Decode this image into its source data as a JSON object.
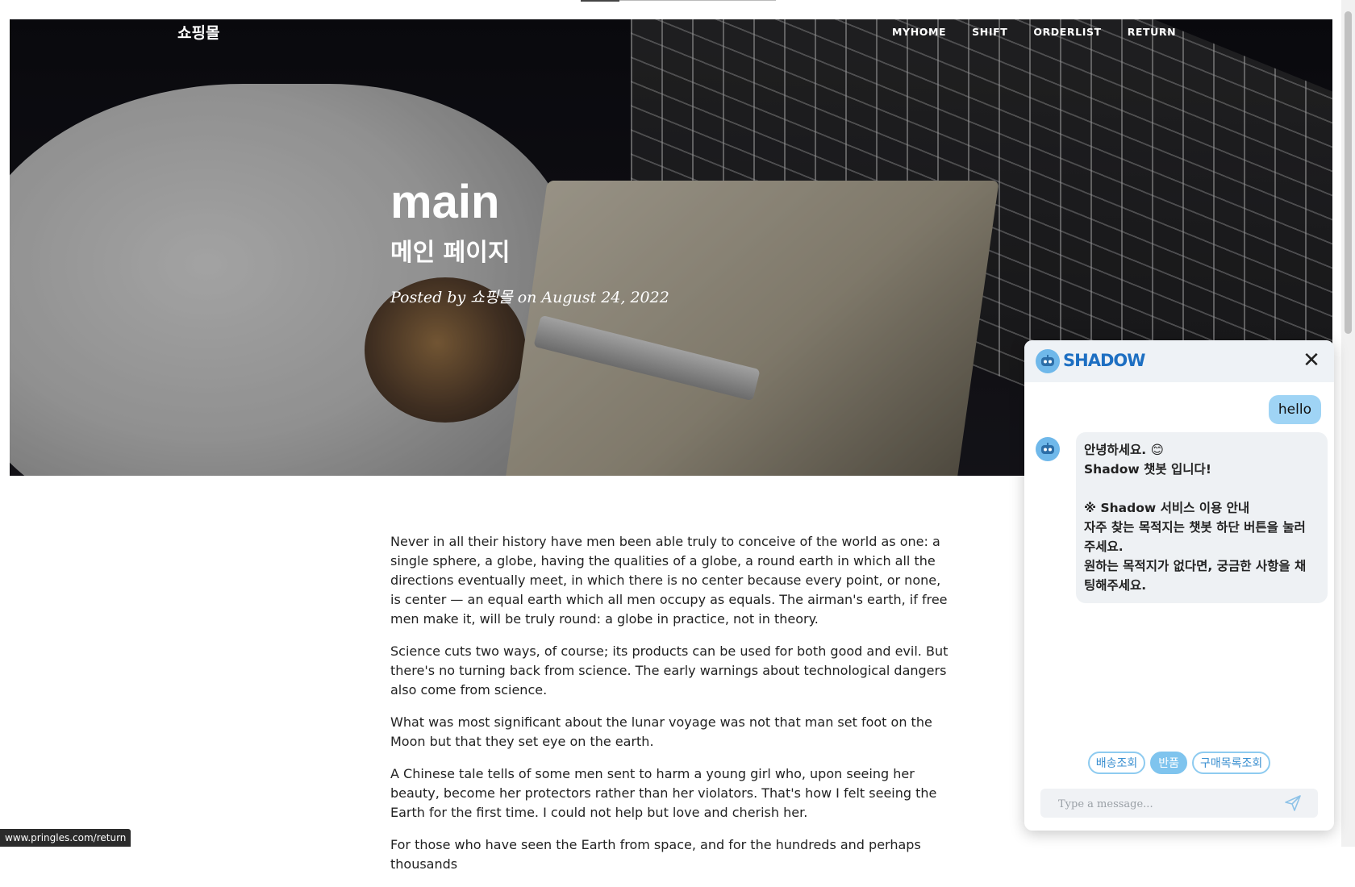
{
  "statusbar": {
    "url": "www.pringles.com/return"
  },
  "navbar": {
    "brand": "쇼핑몰",
    "links": [
      "MYHOME",
      "SHIFT",
      "ORDERLIST",
      "RETURN"
    ]
  },
  "hero": {
    "title": "main",
    "subtitle": "메인 페이지",
    "meta": "Posted by 쇼핑몰 on August 24, 2022"
  },
  "article": {
    "paragraphs": [
      "Never in all their history have men been able truly to conceive of the world as one: a single sphere, a globe, having the qualities of a globe, a round earth in which all the directions eventually meet, in which there is no center because every point, or none, is center — an equal earth which all men occupy as equals. The airman's earth, if free men make it, will be truly round: a globe in practice, not in theory.",
      "Science cuts two ways, of course; its products can be used for both good and evil. But there's no turning back from science. The early warnings about technological dangers also come from science.",
      "What was most significant about the lunar voyage was not that man set foot on the Moon but that they set eye on the earth.",
      "A Chinese tale tells of some men sent to harm a young girl who, upon seeing her beauty, become her protectors rather than her violators. That's how I felt seeing the Earth for the first time. I could not help but love and cherish her.",
      "For those who have seen the Earth from space, and for the hundreds and perhaps thousands"
    ]
  },
  "chat": {
    "brand": "SHADOW",
    "close_label": "✕",
    "user_message": "hello",
    "bot_lines": [
      "안녕하세요. 😊",
      "Shadow 챗봇 입니다!",
      "",
      "※ Shadow 서비스 이용 안내",
      "자주 찾는 목적지는 챗봇 하단 버튼을 눌러",
      "주세요.",
      "원하는 목적지가 없다면, 궁금한 사항을 채",
      "팅해주세요."
    ],
    "quick_buttons": [
      {
        "label": "배송조회",
        "active": false
      },
      {
        "label": "반품",
        "active": true
      },
      {
        "label": "구매목록조회",
        "active": false
      }
    ],
    "input_placeholder": "Type a message...",
    "accent_color": "#7fc4ee"
  }
}
